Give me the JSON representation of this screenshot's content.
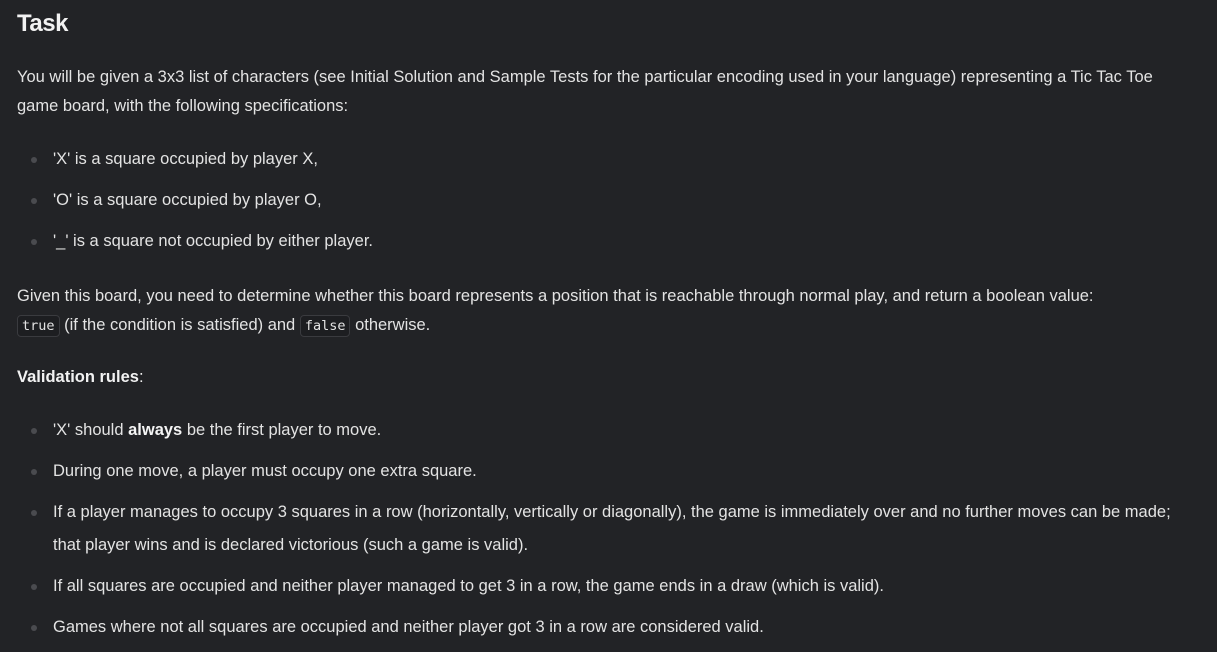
{
  "title": "Task",
  "intro": "You will be given a 3x3 list of characters (see Initial Solution and Sample Tests for the particular encoding used in your language) representing a Tic Tac Toe game board, with the following specifications:",
  "specs": [
    "'X' is a square occupied by player X,",
    "'O' is a square occupied by player O,",
    "'_' is a square not occupied by either player."
  ],
  "given": {
    "text": "Given this board, you need to determine whether this board represents a position that is reachable through normal play, and return a boolean value:",
    "true_code": "true",
    "middle": "(if the condition is satisfied) and",
    "false_code": "false",
    "end": "otherwise."
  },
  "rules_heading": "Validation rules",
  "rules_colon": ":",
  "rules": [
    {
      "pre": "'X' should ",
      "bold": "always",
      "post": " be the first player to move."
    },
    {
      "pre": "During one move, a player must occupy one extra square.",
      "bold": "",
      "post": ""
    },
    {
      "pre": "If a player manages to occupy 3 squares in a row (horizontally, vertically or diagonally), the game is immediately over and no further moves can be made; that player wins and is declared victorious (such a game is valid).",
      "bold": "",
      "post": ""
    },
    {
      "pre": "If all squares are occupied and neither player managed to get 3 in a row, the game ends in a draw (which is valid).",
      "bold": "",
      "post": ""
    },
    {
      "pre": "Games where not all squares are occupied and neither player got 3 in a row are considered valid.",
      "bold": "",
      "post": ""
    }
  ]
}
